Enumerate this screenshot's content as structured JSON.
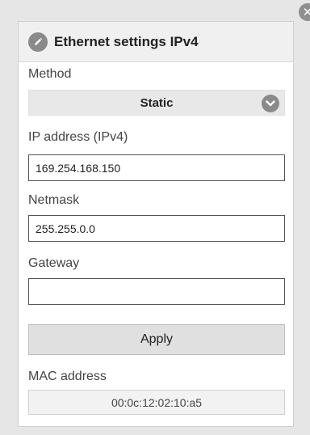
{
  "dialog": {
    "title": "Ethernet settings IPv4",
    "title_icon": "pencil-icon",
    "close_icon": "close-icon",
    "close_glyph": "✕"
  },
  "method": {
    "label": "Method",
    "selected": "Static",
    "dropdown_icon": "chevron-down-icon"
  },
  "ip_address": {
    "label": "IP address (IPv4)",
    "value": "169.254.168.150",
    "placeholder": ""
  },
  "netmask": {
    "label": "Netmask",
    "value": "255.255.0.0",
    "placeholder": ""
  },
  "gateway": {
    "label": "Gateway",
    "value": "",
    "placeholder": ""
  },
  "apply_label": "Apply",
  "mac_address": {
    "label": "MAC address",
    "value": "00:0c:12:02:10:a5"
  }
}
